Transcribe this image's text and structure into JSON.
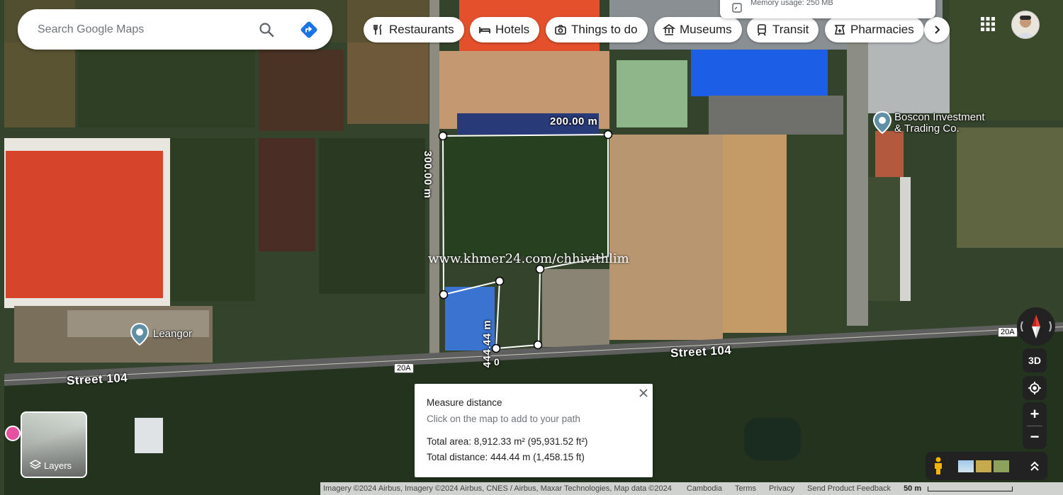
{
  "search": {
    "placeholder": "Search Google Maps"
  },
  "chips": [
    {
      "label": "Restaurants",
      "icon": "fork-knife-icon"
    },
    {
      "label": "Hotels",
      "icon": "bed-icon"
    },
    {
      "label": "Things to do",
      "icon": "camera-icon"
    },
    {
      "label": "Museums",
      "icon": "museum-icon"
    },
    {
      "label": "Transit",
      "icon": "train-icon"
    },
    {
      "label": "Pharmacies",
      "icon": "pharmacy-icon"
    }
  ],
  "memory_tooltip": "Memory usage: 250 MB",
  "places": [
    {
      "name": "Boscon Investment\n& Trading Co."
    },
    {
      "name": "Leangor"
    }
  ],
  "roads": [
    {
      "name": "Street 104"
    },
    {
      "name": "Street 104"
    }
  ],
  "route_shields": [
    "20A",
    "20A"
  ],
  "measure_labels": {
    "top": "200.00 m",
    "left": "300.00 m",
    "bottom": "444.44 m",
    "zero": "0"
  },
  "watermark": "www.khmer24.com/chhivithlim",
  "measure_popup": {
    "title": "Measure distance",
    "subtitle": "Click on the map to add to your path",
    "area": "Total area: 8,912.33 m² (95,931.52 ft²)",
    "distance": "Total distance: 444.44 m (1,458.15 ft)"
  },
  "controls": {
    "three_d": "3D",
    "zoom_in": "+",
    "zoom_out": "−"
  },
  "layers_label": "Layers",
  "footer": {
    "imagery": "Imagery ©2024 Airbus, Imagery ©2024 Airbus, CNES / Airbus, Maxar Technologies, Map data ©2024",
    "links": [
      "Cambodia",
      "Terms",
      "Privacy",
      "Send Product Feedback"
    ],
    "scale": "50 m"
  },
  "colors": {
    "accent": "#1a73e8",
    "measure_line": "#ffffff",
    "place_pin": "#5f8fa5"
  }
}
